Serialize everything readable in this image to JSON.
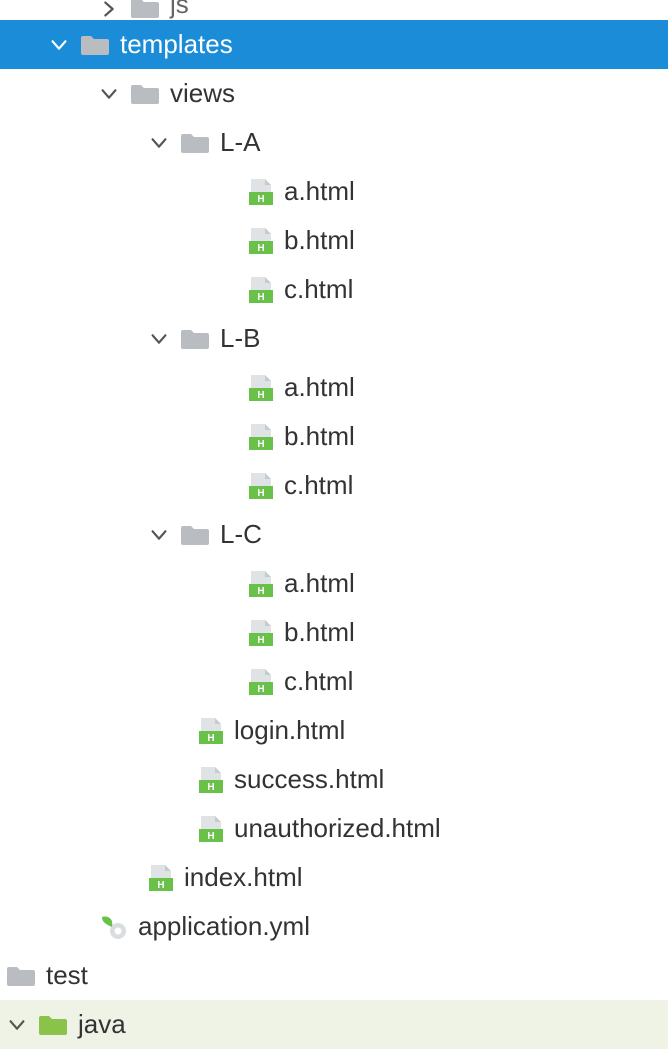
{
  "colors": {
    "selected_bg": "#1a8cd8",
    "selected_fg": "#ffffff",
    "java_bg": "#eef3e6",
    "folder_gray": "#b9bdc1",
    "folder_green": "#8bc34a",
    "file_green": "#6ac14a"
  },
  "tree": {
    "js": {
      "label": "js"
    },
    "templates": {
      "label": "templates"
    },
    "views": {
      "label": "views"
    },
    "la": {
      "label": "L-A"
    },
    "la_a": {
      "label": "a.html"
    },
    "la_b": {
      "label": "b.html"
    },
    "la_c": {
      "label": "c.html"
    },
    "lb": {
      "label": "L-B"
    },
    "lb_a": {
      "label": "a.html"
    },
    "lb_b": {
      "label": "b.html"
    },
    "lb_c": {
      "label": "c.html"
    },
    "lc": {
      "label": "L-C"
    },
    "lc_a": {
      "label": "a.html"
    },
    "lc_b": {
      "label": "b.html"
    },
    "lc_c": {
      "label": "c.html"
    },
    "login": {
      "label": "login.html"
    },
    "success": {
      "label": "success.html"
    },
    "unauthorized": {
      "label": "unauthorized.html"
    },
    "index": {
      "label": "index.html"
    },
    "app_yml": {
      "label": "application.yml"
    },
    "test": {
      "label": "test"
    },
    "java": {
      "label": "java"
    }
  }
}
